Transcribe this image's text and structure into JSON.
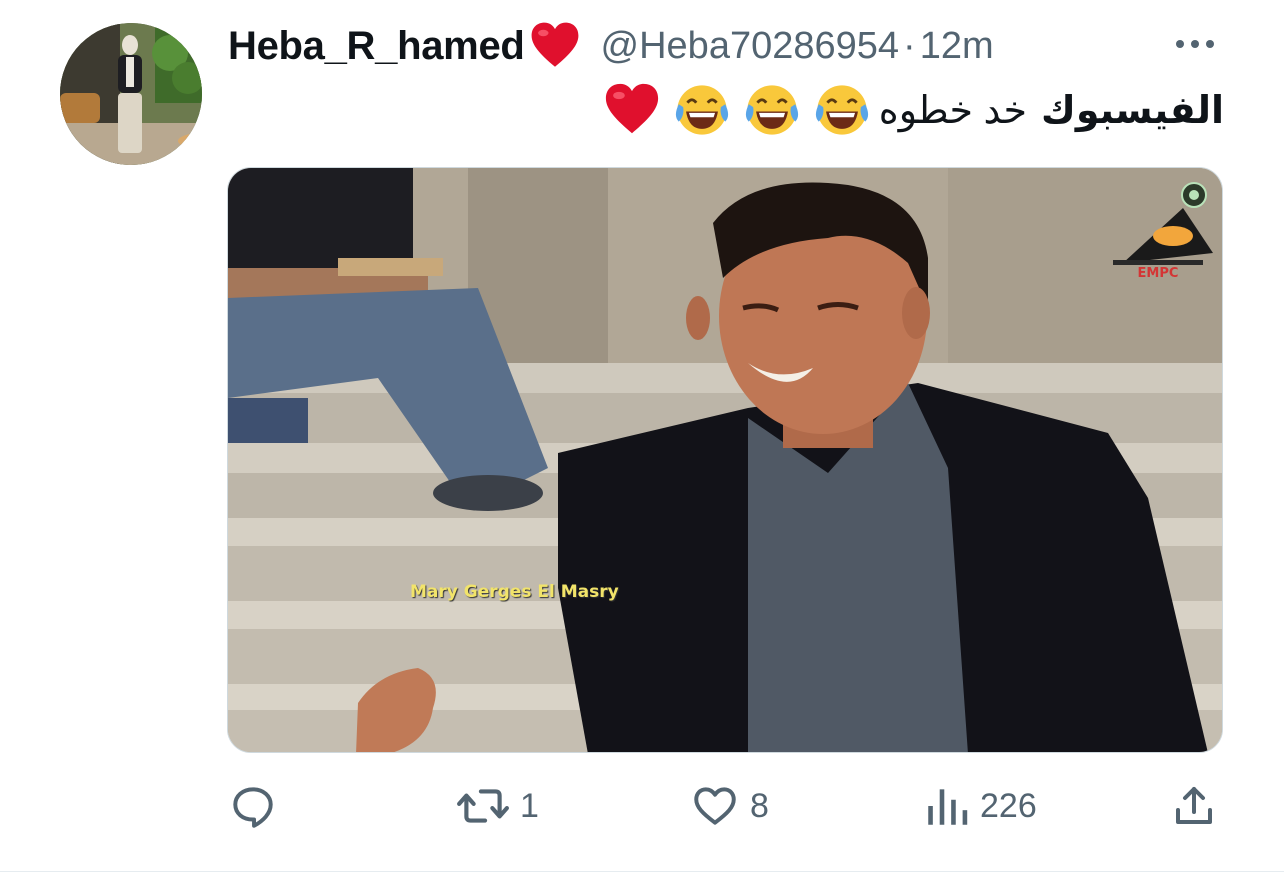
{
  "author": {
    "display_name": "Heba_R_hamed",
    "handle": "@Heba70286954",
    "separator": "·",
    "time": "12m",
    "name_emoji": "red-heart"
  },
  "tweet": {
    "text_bold": "الفيسبوك",
    "text_regular": "خد خطوه",
    "emojis": [
      "face-with-tears-of-joy",
      "face-with-tears-of-joy",
      "face-with-tears-of-joy",
      "red-heart"
    ]
  },
  "media": {
    "overlay_text": "Mary Gerges El Masry",
    "channel_logo_text": "EMPC"
  },
  "actions": {
    "reply_count": "",
    "retweet_count": "1",
    "like_count": "8",
    "views_count": "226"
  },
  "colors": {
    "text": "#0f1419",
    "secondary": "#536471",
    "heart": "#e0102d",
    "emoji_yellow": "#f9c83b"
  }
}
